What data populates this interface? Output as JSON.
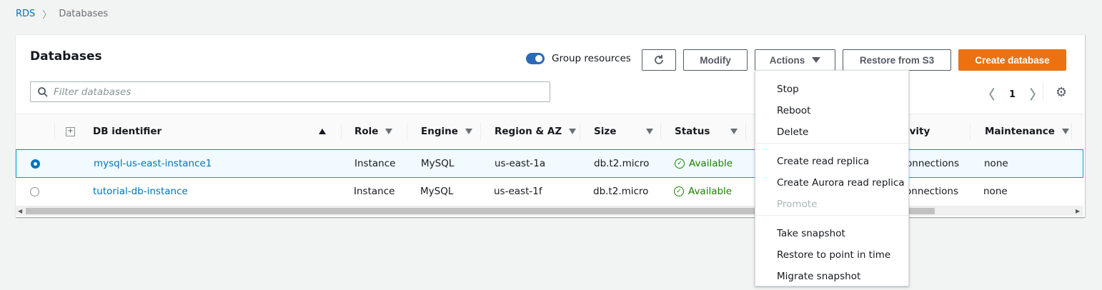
{
  "breadcrumb": {
    "root": "RDS",
    "current": "Databases"
  },
  "panel": {
    "title": "Databases"
  },
  "toolbar": {
    "group_label": "Group resources",
    "modify": "Modify",
    "actions": "Actions",
    "restore": "Restore from S3",
    "create": "Create database"
  },
  "search": {
    "placeholder": "Filter databases"
  },
  "pager": {
    "page": "1"
  },
  "columns": {
    "db_identifier": "DB identifier",
    "role": "Role",
    "engine": "Engine",
    "region": "Region & AZ",
    "size": "Size",
    "status": "Status",
    "activity": "ivity",
    "maintenance": "Maintenance"
  },
  "rows": [
    {
      "id": "mysql-us-east-instance1",
      "role": "Instance",
      "engine": "MySQL",
      "region": "us-east-1a",
      "size": "db.t2.micro",
      "status": "Available",
      "activity": "onnections",
      "maintenance": "none",
      "selected": true
    },
    {
      "id": "tutorial-db-instance",
      "role": "Instance",
      "engine": "MySQL",
      "region": "us-east-1f",
      "size": "db.t2.micro",
      "status": "Available",
      "activity": "onnections",
      "maintenance": "none",
      "selected": false
    }
  ],
  "menu": {
    "stop": "Stop",
    "reboot": "Reboot",
    "delete": "Delete",
    "create_read_replica": "Create read replica",
    "create_aurora_replica": "Create Aurora read replica",
    "promote": "Promote",
    "take_snapshot": "Take snapshot",
    "restore_point": "Restore to point in time",
    "migrate_snapshot": "Migrate snapshot"
  },
  "colors": {
    "link": "#0073bb",
    "primary": "#ec7211",
    "success": "#1d8102",
    "toggle": "#2b6ab8"
  }
}
